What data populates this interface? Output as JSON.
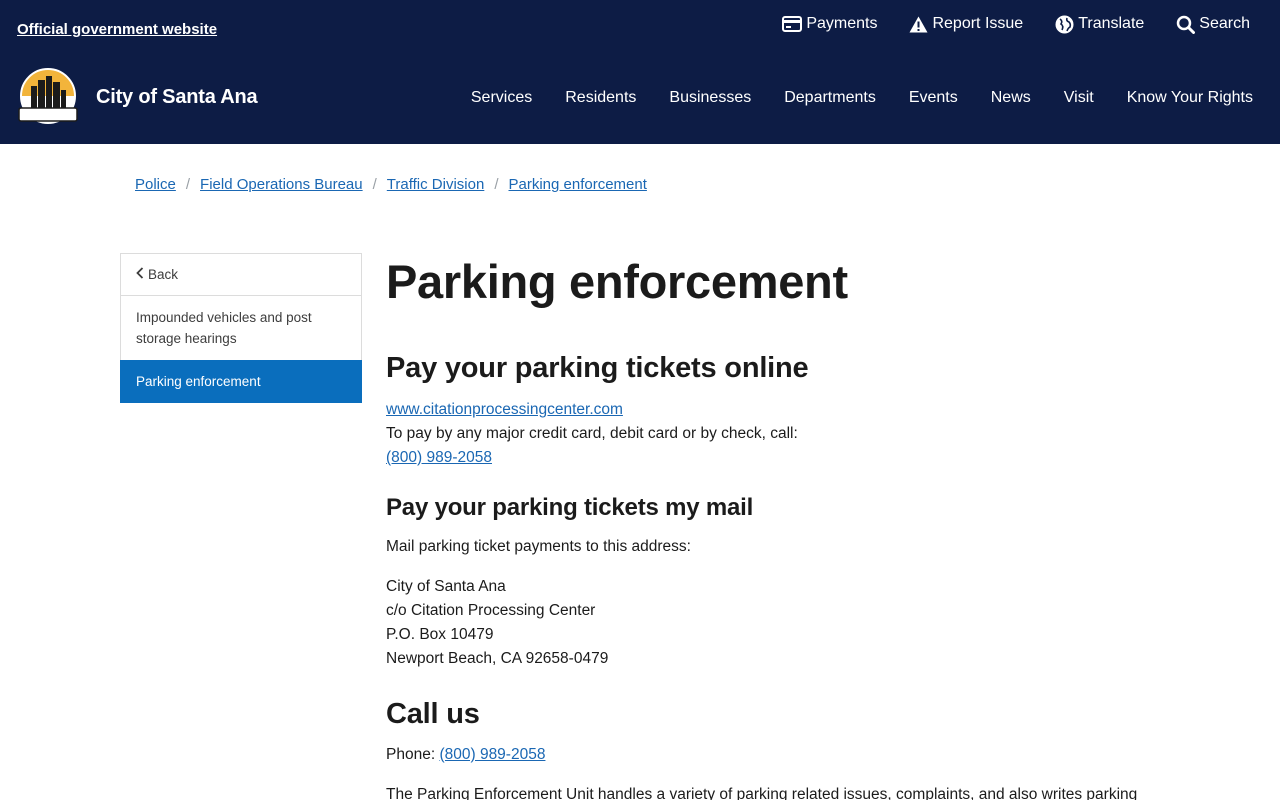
{
  "header": {
    "official_label": "Official government website",
    "utility": [
      {
        "label": "Payments",
        "icon": "credit-card-icon"
      },
      {
        "label": "Report Issue",
        "icon": "warning-icon"
      },
      {
        "label": "Translate",
        "icon": "globe-icon"
      },
      {
        "label": "Search",
        "icon": "search-icon"
      }
    ],
    "site_name": "City of Santa Ana",
    "logo_text": "SANTA ANA",
    "nav": [
      "Services",
      "Residents",
      "Businesses",
      "Departments",
      "Events",
      "News",
      "Visit",
      "Know Your Rights"
    ]
  },
  "breadcrumb": [
    "Police",
    "Field Operations Bureau",
    "Traffic Division",
    "Parking enforcement"
  ],
  "breadcrumb_sep": "/",
  "sidenav": {
    "back_label": "Back",
    "items": [
      {
        "label": "Impounded vehicles and post storage hearings",
        "active": false
      },
      {
        "label": "Parking enforcement",
        "active": true
      }
    ]
  },
  "main": {
    "title": "Parking enforcement",
    "online": {
      "heading": "Pay your parking tickets online",
      "link": "www.citationprocessingcenter.com",
      "text": "To pay by any major credit card, debit card or by check, call:",
      "phone": "(800) 989-2058"
    },
    "mail": {
      "heading": "Pay your parking tickets my mail",
      "intro": "Mail parking ticket payments to this address:",
      "address": [
        "City of Santa Ana",
        "c/o Citation Processing Center",
        "P.O. Box 10479",
        "Newport Beach, CA 92658-0479"
      ]
    },
    "call": {
      "heading": "Call us",
      "phone_label": "Phone:",
      "phone": "(800) 989-2058",
      "description": "The Parking Enforcement Unit handles a variety of parking related issues, complaints, and also writes parking"
    }
  },
  "colors": {
    "header_bg": "#0d1c45",
    "link": "#1a67b3",
    "active_nav": "#0a6ebd"
  }
}
